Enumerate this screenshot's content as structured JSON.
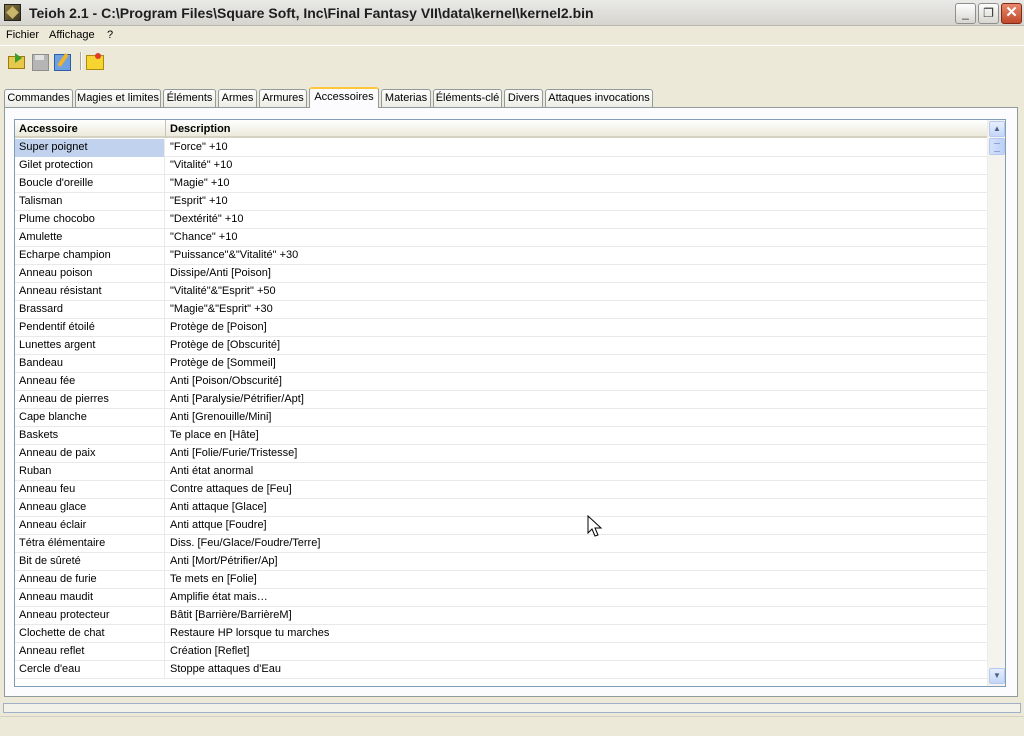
{
  "window": {
    "title": "Teioh 2.1 - C:\\Program Files\\Square Soft, Inc\\Final Fantasy VII\\data\\kernel\\kernel2.bin",
    "icon": "app-icon"
  },
  "menu": {
    "items": [
      "Fichier",
      "Affichage",
      "?"
    ]
  },
  "toolbar": {
    "icons": [
      "open-icon",
      "save-icon",
      "edit-icon",
      "note-icon"
    ]
  },
  "tabs": {
    "items": [
      "Commandes",
      "Magies et limites",
      "Éléments",
      "Armes",
      "Armures",
      "Accessoires",
      "Materias",
      "Éléments-clé",
      "Divers",
      "Attaques invocations"
    ],
    "active": "Accessoires"
  },
  "list": {
    "columns": [
      "Accessoire",
      "Description"
    ],
    "rows": [
      [
        "Super poignet",
        "\"Force\" +10"
      ],
      [
        "Gilet protection",
        "\"Vitalité\" +10"
      ],
      [
        "Boucle d'oreille",
        "\"Magie\" +10"
      ],
      [
        "Talisman",
        "\"Esprit\" +10"
      ],
      [
        "Plume chocobo",
        "\"Dextérité\" +10"
      ],
      [
        "Amulette",
        "\"Chance\" +10"
      ],
      [
        "Echarpe champion",
        "\"Puissance\"&\"Vitalité\" +30"
      ],
      [
        "Anneau poison",
        "Dissipe/Anti [Poison]"
      ],
      [
        "Anneau résistant",
        "\"Vitalité\"&\"Esprit\" +50"
      ],
      [
        "Brassard",
        "\"Magie\"&\"Esprit\" +30"
      ],
      [
        "Pendentif étoilé",
        "Protège de [Poison]"
      ],
      [
        "Lunettes argent",
        "Protège de [Obscurité]"
      ],
      [
        "Bandeau",
        "Protège de [Sommeil]"
      ],
      [
        "Anneau fée",
        "Anti [Poison/Obscurité]"
      ],
      [
        "Anneau de pierres",
        "Anti [Paralysie/Pétrifier/Apt]"
      ],
      [
        "Cape blanche",
        "Anti [Grenouille/Mini]"
      ],
      [
        "Baskets",
        "Te place en [Hâte]"
      ],
      [
        "Anneau de paix",
        "Anti [Folie/Furie/Tristesse]"
      ],
      [
        "Ruban",
        "Anti état anormal"
      ],
      [
        "Anneau feu",
        "Contre attaques de [Feu]"
      ],
      [
        "Anneau glace",
        "Anti attaque [Glace]"
      ],
      [
        "Anneau éclair",
        "Anti attque [Foudre]"
      ],
      [
        "Tétra élémentaire",
        "Diss. [Feu/Glace/Foudre/Terre]"
      ],
      [
        "Bit de sûreté",
        "Anti [Mort/Pétrifier/Ap]"
      ],
      [
        "Anneau de furie",
        "Te mets en [Folie]"
      ],
      [
        "Anneau maudit",
        "Amplifie état mais…"
      ],
      [
        "Anneau protecteur",
        "Bâtit [Barrière/BarrièreM]"
      ],
      [
        "Clochette de chat",
        "Restaure HP lorsque tu marches"
      ],
      [
        "Anneau reflet",
        "Création [Reflet]"
      ],
      [
        "Cercle d'eau",
        "Stoppe attaques d'Eau"
      ]
    ],
    "selected_index": 0
  }
}
